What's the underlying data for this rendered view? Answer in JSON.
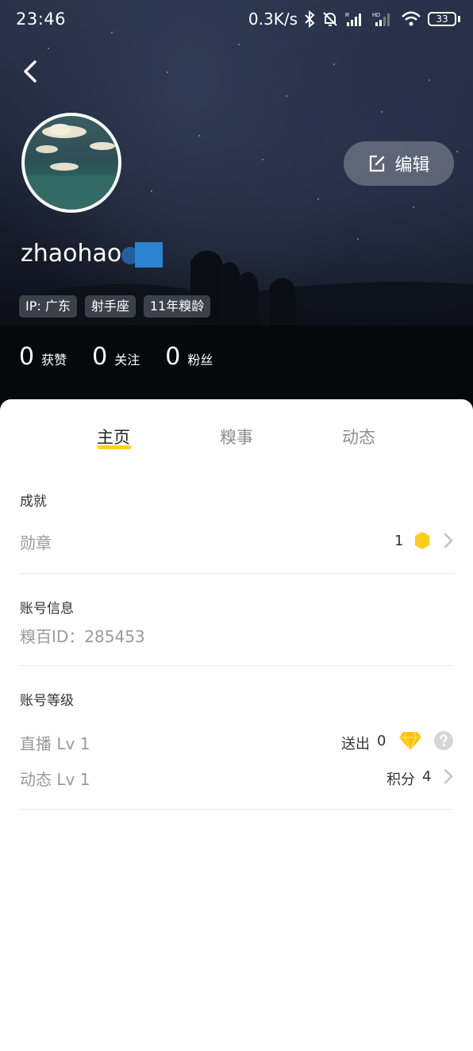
{
  "status_bar": {
    "time": "23:46",
    "net_speed": "0.3K/s",
    "battery": "33",
    "icons": [
      "bluetooth-icon",
      "mute-bell-icon",
      "signal-r-icon",
      "signal-hd-icon",
      "wifi-icon",
      "battery-icon"
    ]
  },
  "profile": {
    "username": "zhaohao",
    "edit_label": "编辑",
    "tags": [
      "IP: 广东",
      "射手座",
      "11年糗龄"
    ],
    "stats": [
      {
        "value": "0",
        "label": "获赞"
      },
      {
        "value": "0",
        "label": "关注"
      },
      {
        "value": "0",
        "label": "粉丝"
      }
    ]
  },
  "tabs": [
    {
      "label": "主页",
      "active": true
    },
    {
      "label": "糗事",
      "active": false
    },
    {
      "label": "动态",
      "active": false
    }
  ],
  "achievements": {
    "title": "成就",
    "medal_label": "勋章",
    "medal_count": "1"
  },
  "account_info": {
    "title": "账号信息",
    "id_text": "糗百ID：285453"
  },
  "account_level": {
    "title": "账号等级",
    "live_label": "直播  Lv 1",
    "sent_label": "送出",
    "sent_value": "0",
    "feed_label": "动态 Lv 1",
    "points_label": "积分",
    "points_value": "4"
  },
  "colors": {
    "accent_yellow": "#ffd21f",
    "verify_blue": "#2a84cf",
    "medal_yellow": "#ffcc1a"
  }
}
